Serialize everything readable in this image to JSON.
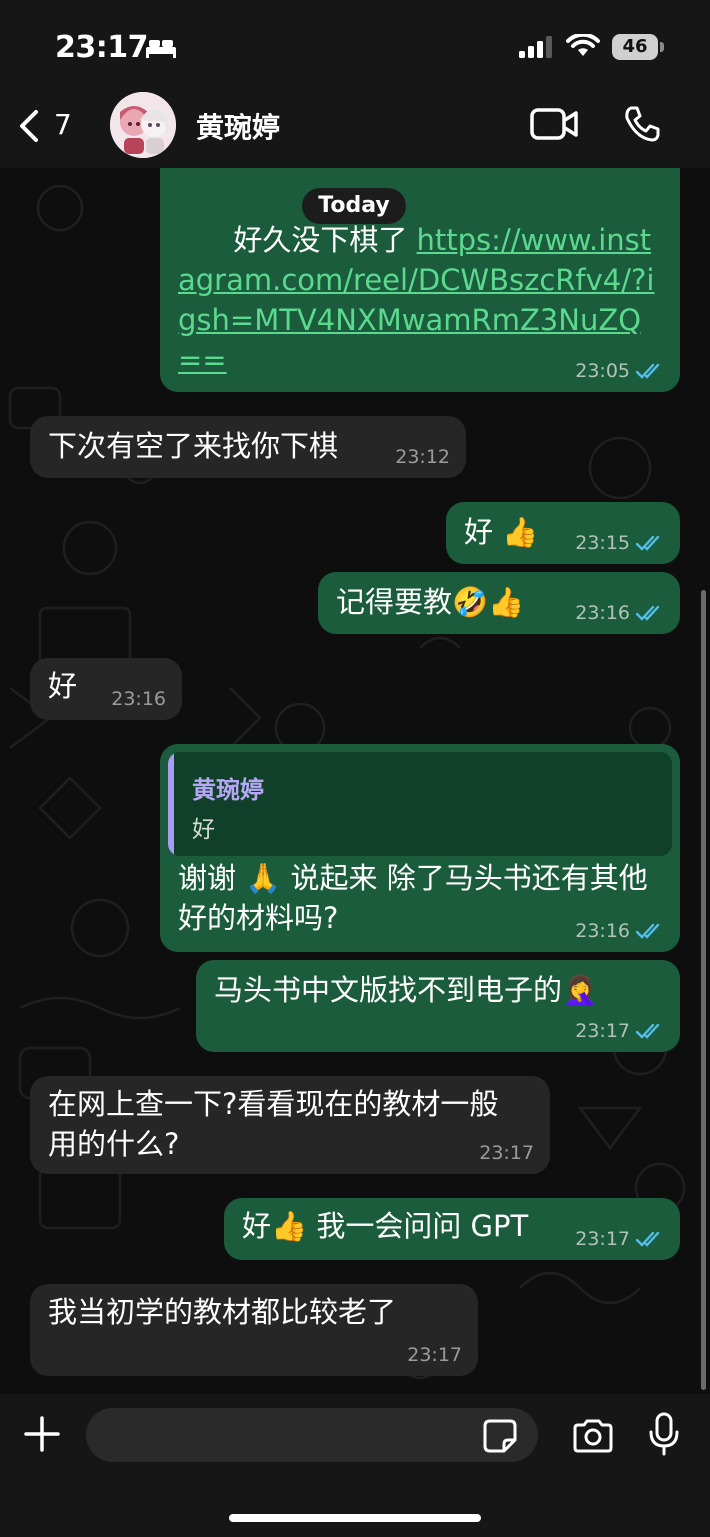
{
  "status_bar": {
    "time": "23:17",
    "battery": "46"
  },
  "header": {
    "back_count": "7",
    "contact_name": "黄琬婷"
  },
  "date_chip": "Today",
  "messages": [
    {
      "direction": "out",
      "text_prefix": "好久没下棋了 ",
      "link": "https://www.instagram.com/reel/DCWBszcRfv4/?igsh=MTV4NXMwamRmZ3NuZQ==",
      "time": "23:05"
    },
    {
      "direction": "in",
      "text": "下次有空了来找你下棋",
      "time": "23:12"
    },
    {
      "direction": "out",
      "text": "好 👍",
      "time": "23:15"
    },
    {
      "direction": "out",
      "text": "记得要教🤣👍",
      "time": "23:16"
    },
    {
      "direction": "in",
      "text": "好",
      "time": "23:16"
    },
    {
      "direction": "out",
      "quote_name": "黄琬婷",
      "quote_text": "好",
      "text": "谢谢 🙏 说起来 除了马头书还有其他好的材料吗?",
      "time": "23:16"
    },
    {
      "direction": "out",
      "text": "马头书中文版找不到电子的🤦‍♀️",
      "time": "23:17"
    },
    {
      "direction": "in",
      "text": "在网上查一下?看看现在的教材一般用的什么?",
      "time": "23:17"
    },
    {
      "direction": "out",
      "text": "好👍 我一会问问 GPT",
      "time": "23:17"
    },
    {
      "direction": "in",
      "text": "我当初学的教材都比较老了",
      "time": "23:17"
    }
  ],
  "composer": {
    "placeholder": ""
  },
  "colors": {
    "outgoing_bubble": "#1a5c3c",
    "incoming_bubble": "#262626",
    "read_ticks": "#53bdeb",
    "link": "#5cd98e",
    "quote_accent": "#a99cf5"
  }
}
